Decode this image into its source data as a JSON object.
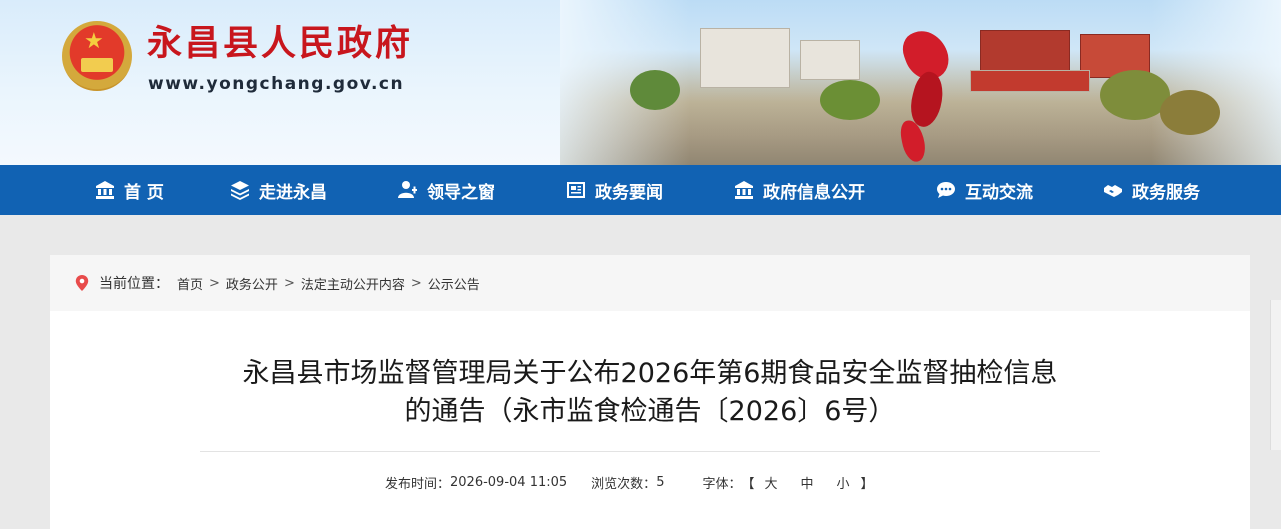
{
  "site": {
    "title": "永昌县人民政府",
    "url": "www.yongchang.gov.cn"
  },
  "nav": {
    "items": [
      {
        "label": "首 页",
        "icon": "bank-icon"
      },
      {
        "label": "走进永昌",
        "icon": "layers-icon"
      },
      {
        "label": "领导之窗",
        "icon": "users-icon"
      },
      {
        "label": "政务要闻",
        "icon": "newspaper-icon"
      },
      {
        "label": "政府信息公开",
        "icon": "bank-icon"
      },
      {
        "label": "互动交流",
        "icon": "chat-icon"
      },
      {
        "label": "政务服务",
        "icon": "handshake-icon"
      }
    ]
  },
  "breadcrumb": {
    "prefix": "当前位置：",
    "items": [
      "首页",
      "政务公开",
      "法定主动公开内容",
      "公示公告"
    ],
    "separator": ">"
  },
  "article": {
    "title_line1": "永昌县市场监督管理局关于公布2026年第6期食品安全监督抽检信息",
    "title_line2": "的通告（永市监食检通告〔2026〕6号）",
    "publish_label": "发布时间：",
    "publish_time": "2026-09-04 11:05",
    "views_label": "浏览次数：",
    "views": "5",
    "font_label": "字体：",
    "bracket_open": "【",
    "font_large": "大",
    "font_medium": "中",
    "font_small": "小",
    "bracket_close": "】"
  },
  "colors": {
    "nav_bg": "#1162b3",
    "title_red": "#c8161d"
  }
}
